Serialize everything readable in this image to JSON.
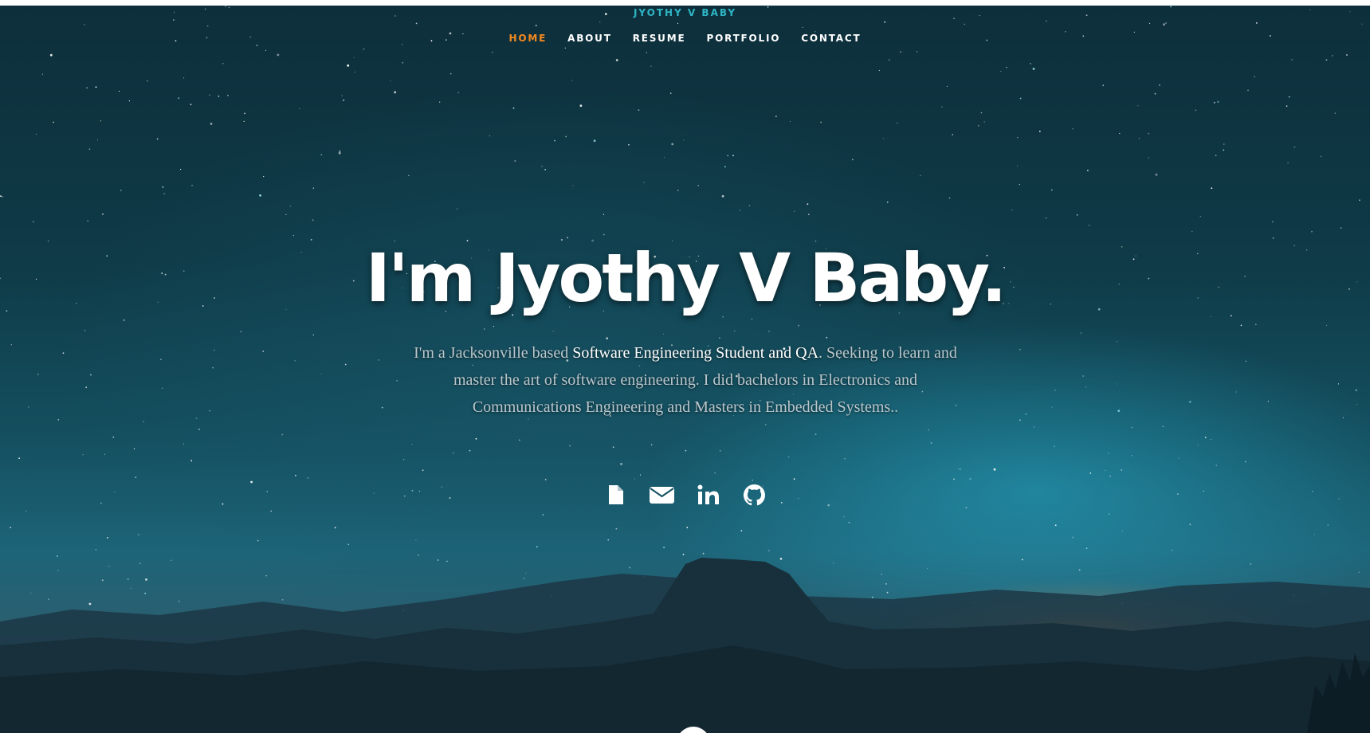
{
  "site": {
    "label": "JYOTHY V BABY"
  },
  "nav": {
    "items": [
      {
        "label": "HOME",
        "active": true
      },
      {
        "label": "ABOUT"
      },
      {
        "label": "RESUME"
      },
      {
        "label": "PORTFOLIO"
      },
      {
        "label": "CONTACT"
      }
    ]
  },
  "hero": {
    "headline": "I'm Jyothy V Baby.",
    "intro_before": "I'm a Jacksonville based ",
    "intro_highlight": "Software Engineering Student and QA",
    "intro_after": ". Seeking to learn and master the art of software engineering. I did bachelors in Electronics and Communications Engineering and Masters in Embedded Systems.."
  },
  "social": {
    "icons": [
      "document-icon",
      "envelope-icon",
      "linkedin-icon",
      "github-icon"
    ]
  },
  "colors": {
    "accent": "#f58a1f",
    "site_label": "#2fb5c5",
    "text": "#ffffff"
  }
}
